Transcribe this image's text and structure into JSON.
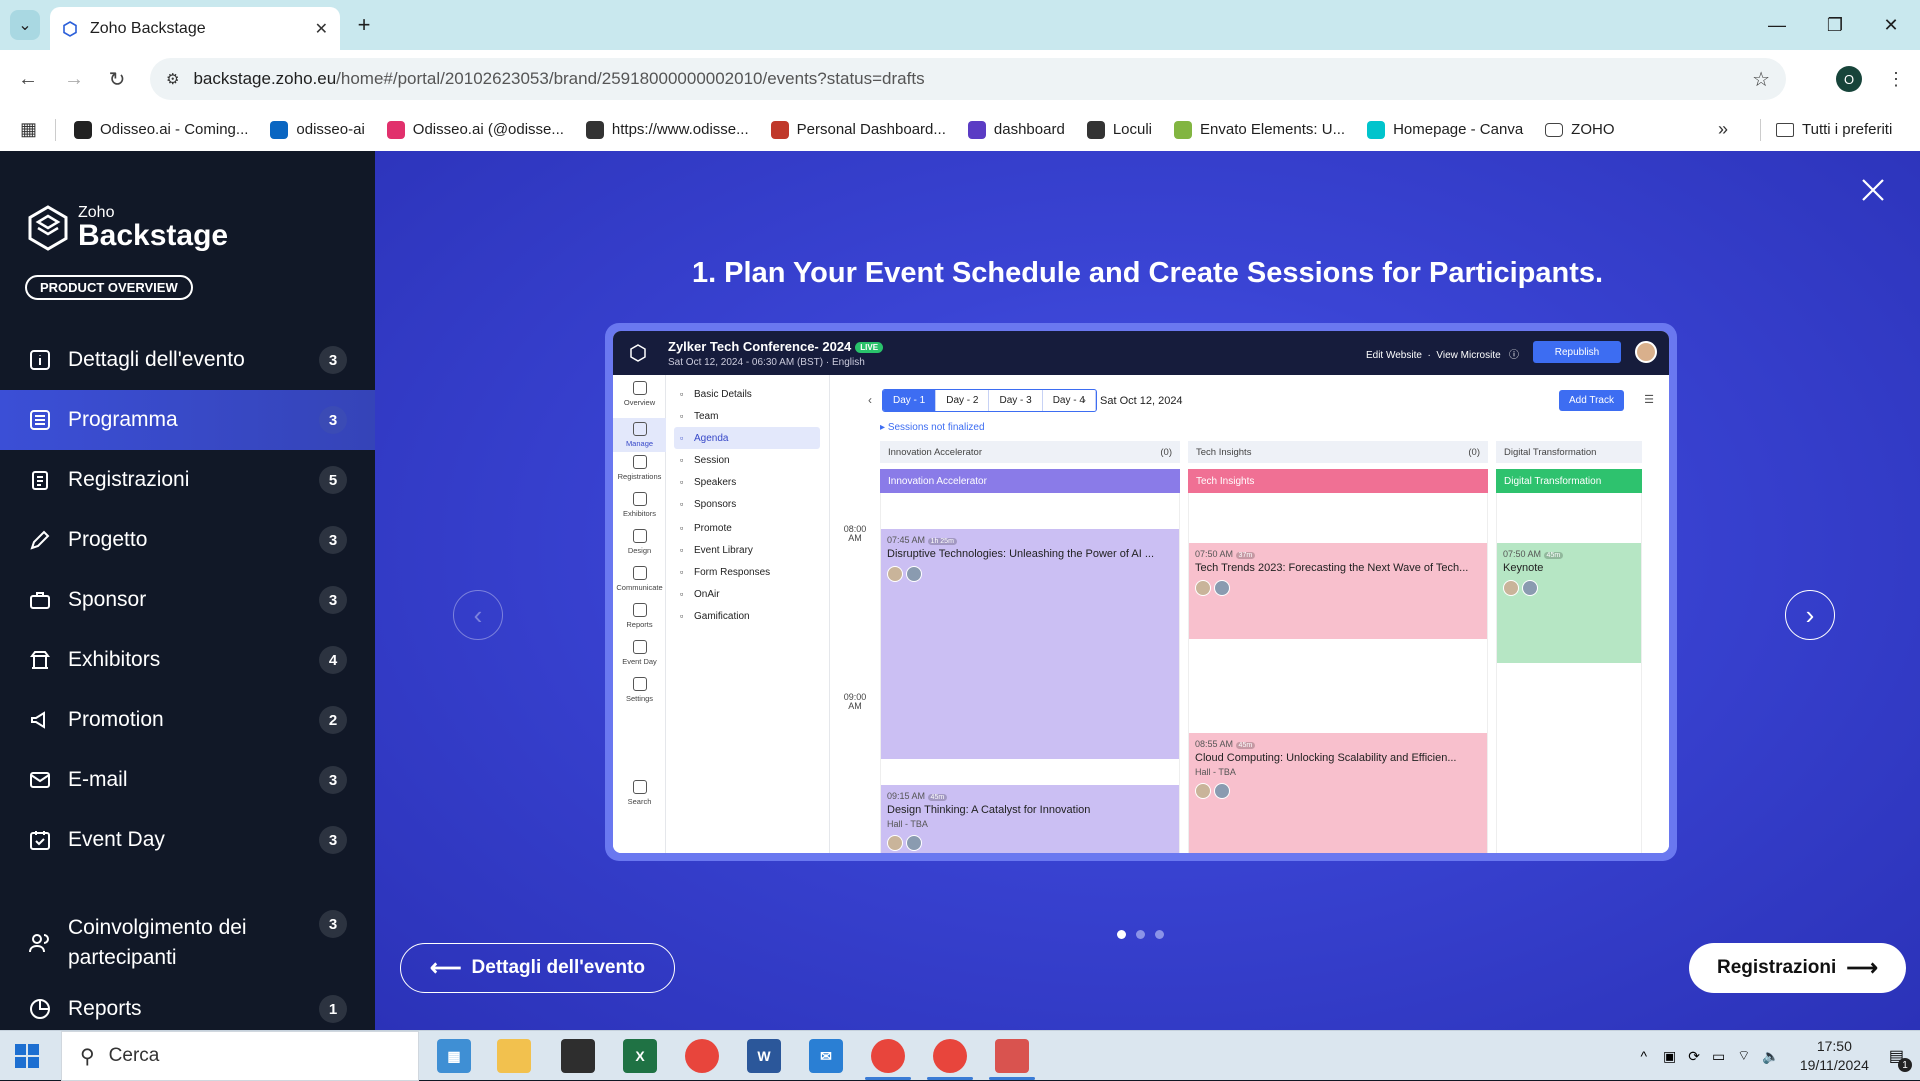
{
  "browser": {
    "tab_title": "Zoho Backstage",
    "url_host": "backstage.zoho.eu",
    "url_path": "/home#/portal/20102623053/brand/25918000000002010/events?status=drafts",
    "profile_initial": "O",
    "bookmarks": [
      {
        "label": "Odisseo.ai - Coming...",
        "color": "#222"
      },
      {
        "label": "odisseo-ai",
        "color": "#0a66c2"
      },
      {
        "label": "Odisseo.ai (@odisse...",
        "color": "#e1306c"
      },
      {
        "label": "https://www.odisse...",
        "color": "#333"
      },
      {
        "label": "Personal Dashboard...",
        "color": "#c0392b"
      },
      {
        "label": "dashboard",
        "color": "#5b3cc4"
      },
      {
        "label": "Loculi",
        "color": "#333"
      },
      {
        "label": "Envato Elements: U...",
        "color": "#82b541"
      },
      {
        "label": "Homepage - Canva",
        "color": "#00c4cc"
      },
      {
        "label": "ZOHO",
        "color": "folder"
      }
    ],
    "all_bookmarks": "Tutti i preferiti"
  },
  "sidebar": {
    "brand_small": "Zoho",
    "brand_large": "Backstage",
    "product_overview": "PRODUCT OVERVIEW",
    "items": [
      {
        "label": "Dettagli dell'evento",
        "count": "3",
        "icon": "info-icon"
      },
      {
        "label": "Programma",
        "count": "3",
        "icon": "list-icon",
        "active": true
      },
      {
        "label": "Registrazioni",
        "count": "5",
        "icon": "clipboard-icon"
      },
      {
        "label": "Progetto",
        "count": "3",
        "icon": "pen-icon"
      },
      {
        "label": "Sponsor",
        "count": "3",
        "icon": "briefcase-icon"
      },
      {
        "label": "Exhibitors",
        "count": "4",
        "icon": "booth-icon"
      },
      {
        "label": "Promotion",
        "count": "2",
        "icon": "megaphone-icon"
      },
      {
        "label": "E-mail",
        "count": "3",
        "icon": "mail-icon"
      },
      {
        "label": "Event Day",
        "count": "3",
        "icon": "calendar-check-icon"
      },
      {
        "label": "Coinvolgimento dei partecipanti",
        "count": "3",
        "icon": "people-icon"
      },
      {
        "label": "Reports",
        "count": "1",
        "icon": "chart-icon"
      }
    ]
  },
  "main": {
    "heading": "1. Plan Your Event Schedule and Create Sessions for Participants.",
    "prev_label": "Dettagli dell'evento",
    "next_label": "Registrazioni",
    "dots_total": 3,
    "dots_active": 0
  },
  "preview": {
    "title": "Zylker Tech Conference- 2024",
    "live": "LIVE",
    "subtitle": "Sat Oct 12, 2024 - 06:30 AM (BST) · English",
    "edit_website": "Edit Website",
    "view_microsite": "View Microsite",
    "republish": "Republish",
    "rail": [
      "Overview",
      "Manage",
      "Registrations",
      "Exhibitors",
      "Design",
      "Communicate",
      "Reports",
      "Event Day",
      "Settings",
      "Search"
    ],
    "menu": [
      "Basic Details",
      "Team",
      "Agenda",
      "Session",
      "Speakers",
      "Sponsors",
      "Promote",
      "Event Library",
      "Form Responses",
      "OnAir",
      "Gamification"
    ],
    "days": [
      "Day - 1",
      "Day - 2",
      "Day - 3",
      "Day - 4"
    ],
    "date": "Sat Oct 12, 2024",
    "add_track": "Add Track",
    "not_finalized": "Sessions not finalized",
    "time_labels": [
      "08:00 AM",
      "09:00 AM"
    ],
    "columns": [
      {
        "name": "Innovation Accelerator",
        "count": "(0)",
        "color": "#8a7be8",
        "card": "#cbbff3",
        "sessions": [
          {
            "time": "07:45 AM",
            "dur": "1h 25m",
            "name": "Disruptive Technologies: Unleashing the Power of AI ...",
            "hall": ""
          },
          {
            "time": "09:15 AM",
            "dur": "45m",
            "name": "Design Thinking: A Catalyst for Innovation",
            "hall": "Hall - TBA"
          }
        ]
      },
      {
        "name": "Tech Insights",
        "count": "(0)",
        "color": "#f07094",
        "card": "#f8c0cd",
        "sessions": [
          {
            "time": "07:50 AM",
            "dur": "37m",
            "name": "Tech Trends 2023: Forecasting the Next Wave of Tech...",
            "hall": ""
          },
          {
            "time": "08:55 AM",
            "dur": "45m",
            "name": "Cloud Computing: Unlocking Scalability and Efficien...",
            "hall": "Hall - TBA"
          }
        ]
      },
      {
        "name": "Digital Transformation",
        "count": "",
        "color": "#2ec26e",
        "card": "#b6e6c4",
        "sessions": [
          {
            "time": "07:50 AM",
            "dur": "45m",
            "name": "Keynote",
            "hall": ""
          }
        ]
      }
    ]
  },
  "taskbar": {
    "search_placeholder": "Cerca",
    "time": "17:50",
    "date": "19/11/2024",
    "notif_count": "1"
  }
}
